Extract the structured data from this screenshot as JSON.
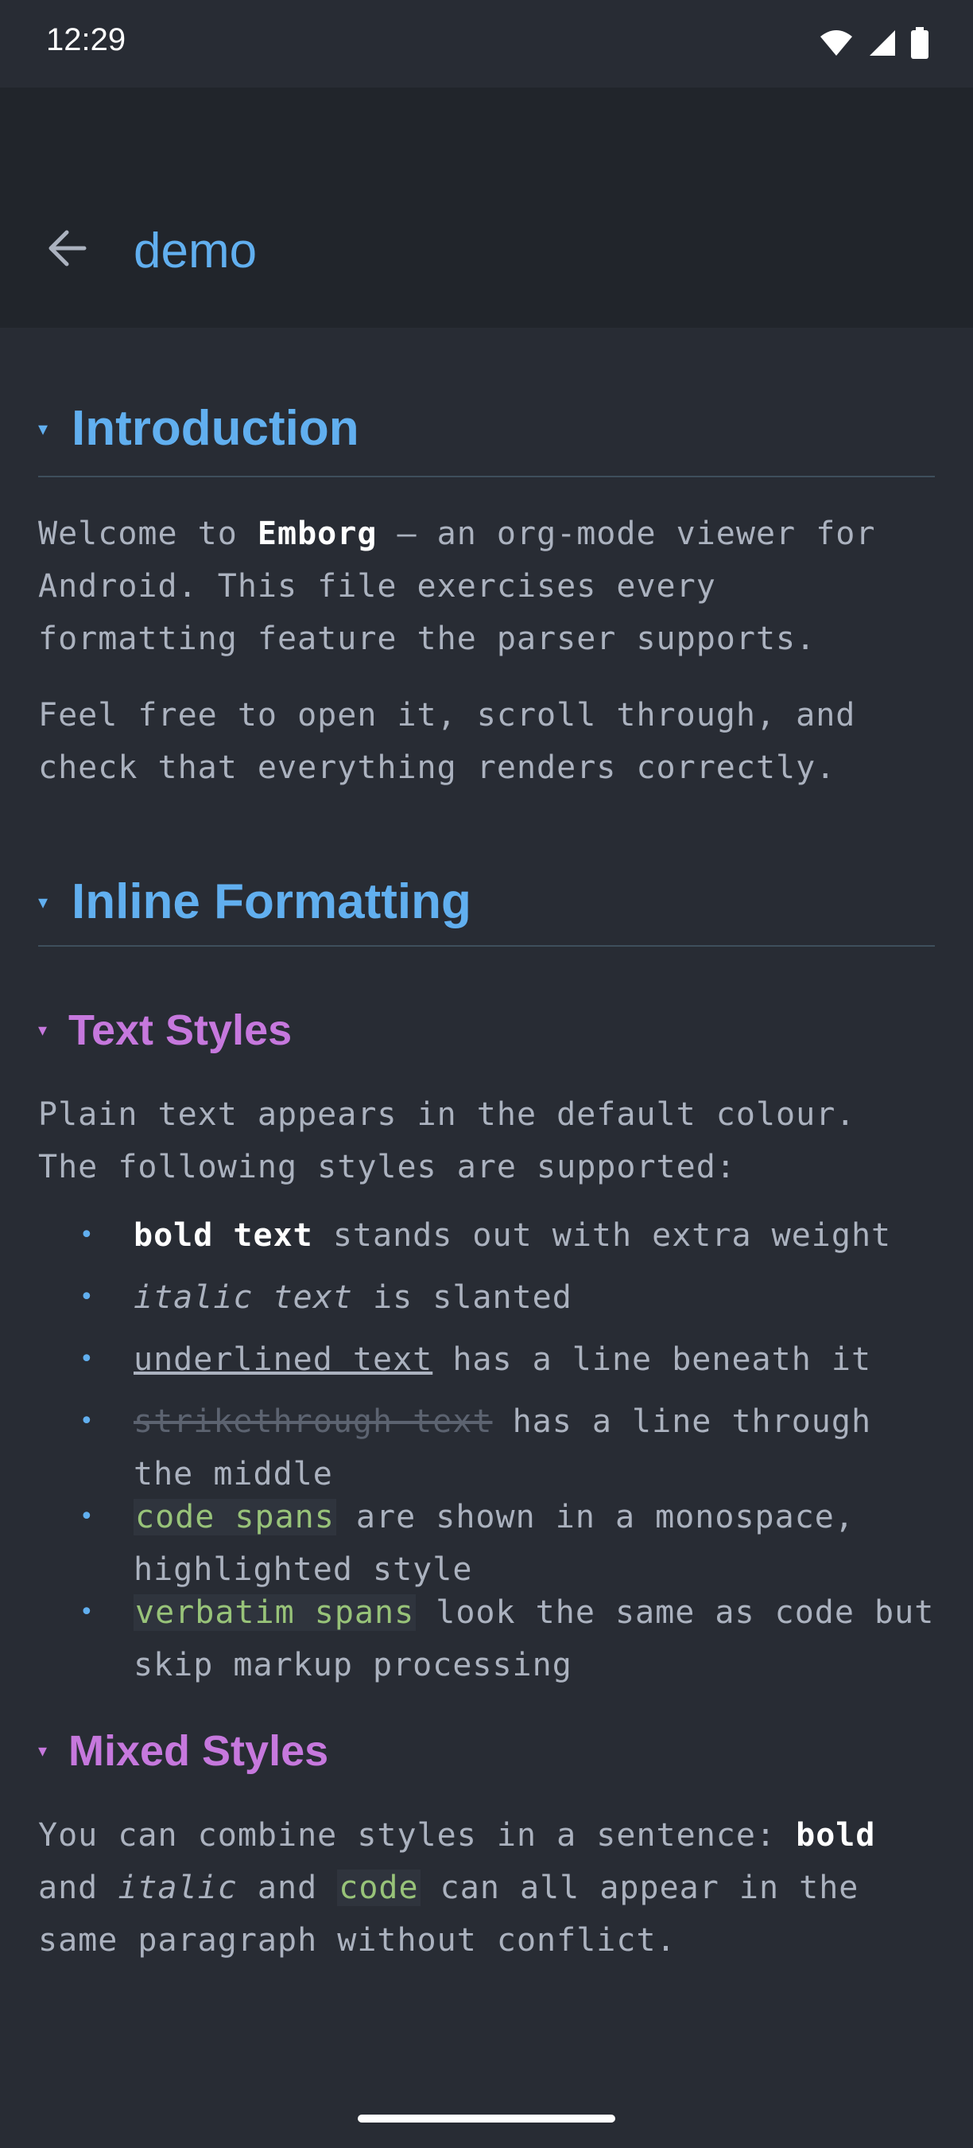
{
  "status_bar": {
    "time": "12:29"
  },
  "app_bar": {
    "title": "demo"
  },
  "sections": {
    "intro": {
      "heading": "Introduction",
      "p1": {
        "pre": "Welcome to ",
        "bold": "Emborg",
        "post": " — an org-mode viewer for Android. This file exercises every formatting feature the parser supports."
      },
      "p2": "Feel free to open it, scroll through, and check that everything renders correctly."
    },
    "inline": {
      "heading": "Inline Formatting",
      "text_styles": {
        "heading": "Text Styles",
        "intro": "Plain text appears in the default colour. The following styles are supported:",
        "items": [
          {
            "styled": "bold text",
            "rest": " stands out with extra weight"
          },
          {
            "styled": "italic text",
            "rest": " is slanted"
          },
          {
            "styled": "underlined text",
            "rest": " has a line beneath it"
          },
          {
            "styled": "strikethrough text",
            "rest": " has a line through the middle"
          },
          {
            "styled": "code spans",
            "rest": " are shown in a monospace, highlighted style"
          },
          {
            "styled": "verbatim spans",
            "rest": " look the same as code but skip markup processing"
          }
        ]
      },
      "mixed_styles": {
        "heading": "Mixed Styles",
        "p": {
          "a": "You can combine styles in a sentence: ",
          "bold": "bold",
          "b": " and ",
          "italic": "italic",
          "c": " and ",
          "code": "code",
          "d": " can all appear in the same paragraph without conflict."
        }
      }
    }
  },
  "bullet_glyph": "•",
  "caret_glyph": "▾",
  "icons": [
    "wifi-icon",
    "signal-icon",
    "battery-icon",
    "back-arrow-icon"
  ],
  "colors": {
    "background": "#282c34",
    "app_bar": "#21252b",
    "h1": "#61afef",
    "h2": "#c678dd",
    "code": "#98c379",
    "text": "#abb2bf"
  }
}
